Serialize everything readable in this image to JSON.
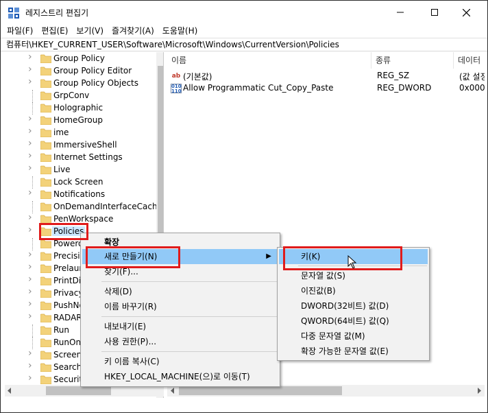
{
  "window": {
    "title": "레지스트리 편집기",
    "accent_color": "#1e5ab4"
  },
  "menubar": {
    "items": [
      "파일(F)",
      "편집(E)",
      "보기(V)",
      "즐겨찾기(A)",
      "도움말(H)"
    ]
  },
  "address": {
    "path": "컴퓨터\\HKEY_CURRENT_USER\\Software\\Microsoft\\Windows\\CurrentVersion\\Policies"
  },
  "tree": {
    "items": [
      {
        "label": "Group Policy",
        "chevron": true
      },
      {
        "label": "Group Policy Editor",
        "chevron": true
      },
      {
        "label": "Group Policy Objects",
        "chevron": true
      },
      {
        "label": "GrpConv",
        "chevron": false
      },
      {
        "label": "Holographic",
        "chevron": false
      },
      {
        "label": "HomeGroup",
        "chevron": true
      },
      {
        "label": "ime",
        "chevron": true
      },
      {
        "label": "ImmersiveShell",
        "chevron": true
      },
      {
        "label": "Internet Settings",
        "chevron": true
      },
      {
        "label": "Live",
        "chevron": true
      },
      {
        "label": "Lock Screen",
        "chevron": false
      },
      {
        "label": "Notifications",
        "chevron": true
      },
      {
        "label": "OnDemandInterfaceCache",
        "chevron": false
      },
      {
        "label": "PenWorkspace",
        "chevron": true
      },
      {
        "label": "Policies",
        "chevron": true,
        "selected": true
      },
      {
        "label": "Powero",
        "chevron": false
      },
      {
        "label": "Precisio",
        "chevron": true
      },
      {
        "label": "Prelaun",
        "chevron": true
      },
      {
        "label": "PrintDi",
        "chevron": true
      },
      {
        "label": "Privacy",
        "chevron": true
      },
      {
        "label": "PushNo",
        "chevron": true
      },
      {
        "label": "RADAR",
        "chevron": true
      },
      {
        "label": "Run",
        "chevron": false
      },
      {
        "label": "RunOnc",
        "chevron": false
      },
      {
        "label": "Screens",
        "chevron": true
      },
      {
        "label": "Search",
        "chevron": true
      },
      {
        "label": "Securit",
        "chevron": true
      }
    ]
  },
  "list": {
    "columns": {
      "name": "이름",
      "type": "종류",
      "data": "데이터"
    },
    "rows": [
      {
        "icon": "string-value-icon",
        "name": "(기본값)",
        "type": "REG_SZ",
        "data": "(값 설정"
      },
      {
        "icon": "dword-value-icon",
        "name": "Allow Programmatic Cut_Copy_Paste",
        "type": "REG_DWORD",
        "data": "0x000"
      }
    ]
  },
  "context_menu": {
    "expand": "확장",
    "new": "새로 만들기(N)",
    "find": "찾기(F)...",
    "delete": "삭제(D)",
    "rename": "이름 바꾸기(R)",
    "export": "내보내기(E)",
    "permissions": "사용 권한(P)...",
    "copy_key_name": "키 이름 복사(C)",
    "goto_hklm": "HKEY_LOCAL_MACHINE(으)로 이동(T)"
  },
  "submenu": {
    "key": "키(K)",
    "string": "문자열 값(S)",
    "binary": "이진값(B)",
    "dword": "DWORD(32비트) 값(D)",
    "qword": "QWORD(64비트) 값(Q)",
    "multi_string": "다중 문자열 값(M)",
    "expand_string": "확장 가능한 문자열 값(E)"
  },
  "highlight_color": "#e01b1b"
}
